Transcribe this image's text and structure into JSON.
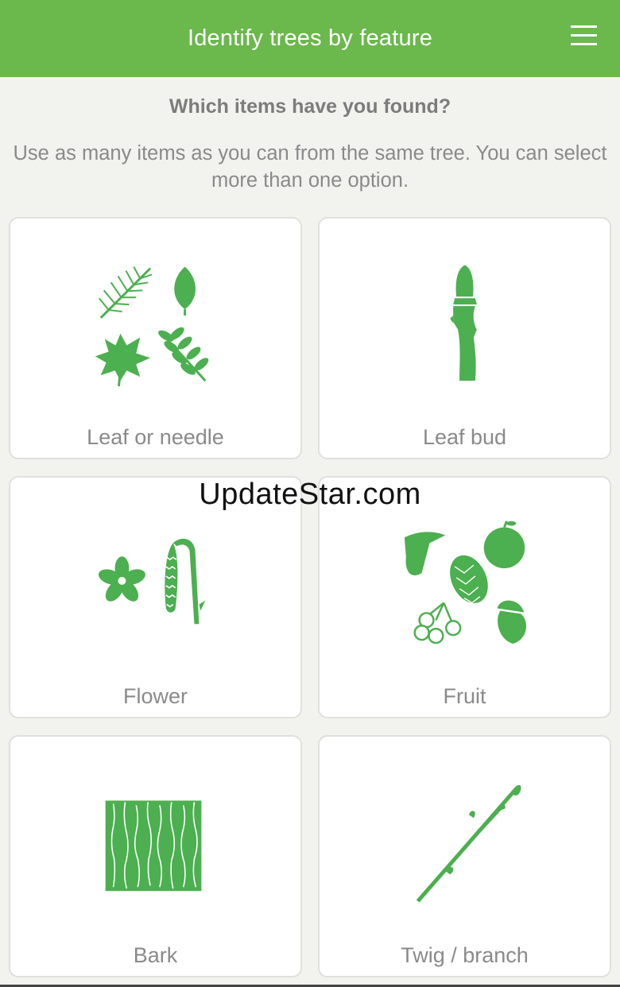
{
  "header": {
    "title": "Identify trees by feature",
    "menu_icon": "hamburger-menu-icon"
  },
  "question": "Which items have you found?",
  "instructions": "Use as many items as you can from the same tree. You can select more than one option.",
  "options": [
    {
      "label": "Leaf or needle",
      "icon": "leaf-needle-icon"
    },
    {
      "label": "Leaf bud",
      "icon": "leaf-bud-icon"
    },
    {
      "label": "Flower",
      "icon": "flower-icon"
    },
    {
      "label": "Fruit",
      "icon": "fruit-icon"
    },
    {
      "label": "Bark",
      "icon": "bark-icon"
    },
    {
      "label": "Twig / branch",
      "icon": "twig-branch-icon"
    }
  ],
  "watermark": "UpdateStar.com",
  "colors": {
    "accent": "#6bb84c",
    "icon_green": "#4caf50",
    "background": "#f2f2ee",
    "card": "#ffffff",
    "text_grey": "#8a8a8a"
  }
}
